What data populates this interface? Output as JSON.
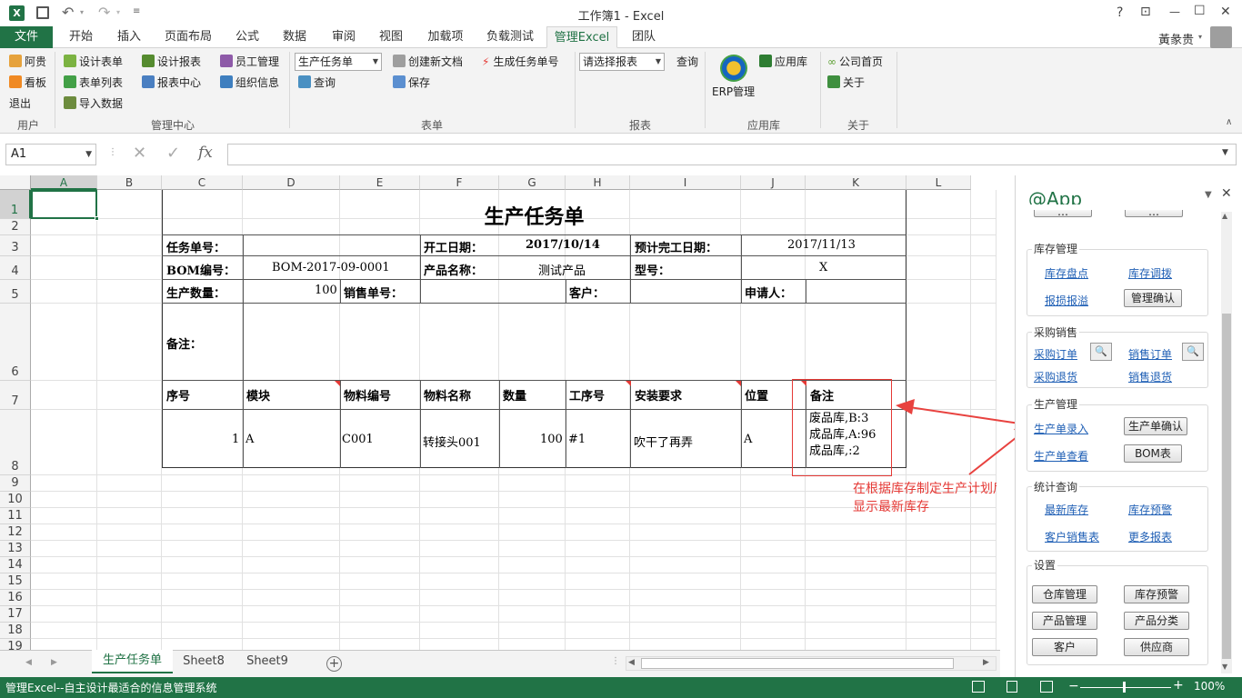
{
  "title_bar": {
    "title": "工作簿1 - Excel",
    "help": "?",
    "restore_ribbon": "⊡",
    "minimize": "—",
    "maximize": "☐",
    "close": "✕"
  },
  "tabs": [
    "文件",
    "开始",
    "插入",
    "页面布局",
    "公式",
    "数据",
    "审阅",
    "视图",
    "加载项",
    "负载测试",
    "管理Excel",
    "团队"
  ],
  "user": "黃彖贵",
  "ribbon": {
    "user_group": {
      "label": "用户",
      "items": [
        "阿贵",
        "看板",
        "退出"
      ]
    },
    "mgmt_group": {
      "label": "管理中心",
      "items": [
        "设计表单",
        "表单列表",
        "导入数据",
        "设计报表",
        "报表中心",
        "员工管理",
        "组织信息"
      ]
    },
    "form_group": {
      "label": "表单",
      "combo": "生产任务单",
      "query": "查询",
      "new_doc": "创建新文档",
      "save": "保存",
      "gen_task": "生成任务单号"
    },
    "report_group": {
      "label": "报表",
      "combo": "请选择报表",
      "query": "查询"
    },
    "app_group": {
      "label": "应用库",
      "erp": "ERP管理",
      "app_lib": "应用库"
    },
    "about_group": {
      "label": "关于",
      "home": "公司首页",
      "about": "关于"
    }
  },
  "formula_bar": {
    "name_box": "A1",
    "fx": "fx",
    "value": ""
  },
  "columns": [
    "A",
    "B",
    "C",
    "D",
    "E",
    "F",
    "G",
    "H",
    "I",
    "J",
    "K",
    "L"
  ],
  "rows": [
    "1",
    "2",
    "3",
    "4",
    "5",
    "6",
    "7",
    "8",
    "9",
    "10",
    "11",
    "12",
    "13",
    "14",
    "15",
    "16",
    "17",
    "18",
    "19"
  ],
  "sheet": {
    "title": "生产任务单",
    "task_no_label": "任务单号：",
    "start_date_label": "开工日期：",
    "start_date": "2017/10/14",
    "finish_date_label": "预计完工日期：",
    "finish_date": "2017/11/13",
    "bom_label": "BOM编号：",
    "bom_value": "BOM-2017-09-0001",
    "product_label": "产品名称：",
    "product_value": "测试产品",
    "model_label": "型号：",
    "model_value": "X",
    "qty_label": "生产数量：",
    "qty_value": "100",
    "sales_no_label": "销售单号：",
    "customer_label": "客户：",
    "applicant_label": "申请人：",
    "remark_label": "备注：",
    "headers": [
      "序号",
      "模块",
      "物料编号",
      "物料名称",
      "数量",
      "工序号",
      "安装要求",
      "位置",
      "备注"
    ],
    "row": {
      "seq": "1",
      "module": "A",
      "code": "C001",
      "name": "转接头001",
      "qty": "100",
      "proc": "#1",
      "install": "吹干了再弄",
      "pos": "A",
      "remark": [
        "废品库,B:3",
        "成品库,A:96",
        "成品库,:2"
      ]
    }
  },
  "annotation": {
    "line1": "在根据库存制定生产计划后,",
    "line2": "显示最新库存"
  },
  "sheet_tabs": [
    "生产任务单",
    "Sheet8",
    "Sheet9"
  ],
  "status": {
    "text": "管理Excel--自主设计最适合的信息管理系统",
    "zoom": "100%"
  },
  "pane": {
    "title": "@App",
    "top_partial": [
      "…",
      "…"
    ],
    "inventory": {
      "title": "库存管理",
      "check": "库存盘点",
      "transfer": "库存调拨",
      "loss": "报损报溢",
      "confirm": "管理确认"
    },
    "purchase": {
      "title": "采购销售",
      "po": "采购订单",
      "so": "销售订单",
      "po_return": "采购退货",
      "so_return": "销售退货"
    },
    "production": {
      "title": "生产管理",
      "entry": "生产单录入",
      "confirm": "生产单确认",
      "view": "生产单查看",
      "bom": "BOM表"
    },
    "stats": {
      "title": "统计查询",
      "latest": "最新库存",
      "warn": "库存预警",
      "cust_sales": "客户销售表",
      "more": "更多报表"
    },
    "settings": {
      "title": "设置",
      "buttons": [
        "仓库管理",
        "库存预警",
        "产品管理",
        "产品分类",
        "客户",
        "供应商"
      ]
    }
  },
  "colors": {
    "excel_green": "#217346",
    "annotation_red": "#e8423f",
    "link_blue": "#1f5fb5"
  }
}
